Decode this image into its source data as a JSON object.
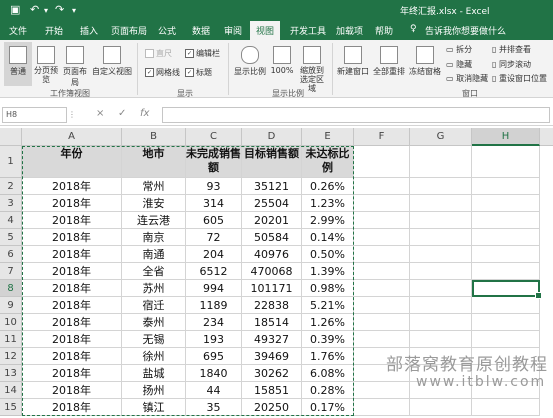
{
  "title_bar": {
    "doc_title": "年终汇报.xlsx  -  Excel"
  },
  "menu_tabs": [
    "文件",
    "开始",
    "插入",
    "页面布局",
    "公式",
    "数据",
    "审阅",
    "视图",
    "开发工具",
    "加载项",
    "帮助"
  ],
  "active_tab": "视图",
  "tell_me": "告诉我你想要做什么",
  "ribbon": {
    "workbook_views": {
      "buttons": [
        "普通",
        "分页预览",
        "页面布局",
        "自定义视图"
      ],
      "group_label": "工作簿视图"
    },
    "show": {
      "checks": [
        {
          "label": "直尺",
          "checked": false,
          "disabled": true
        },
        {
          "label": "编辑栏",
          "checked": true,
          "disabled": false
        },
        {
          "label": "网格线",
          "checked": true,
          "disabled": false
        },
        {
          "label": "标题",
          "checked": true,
          "disabled": false
        }
      ],
      "group_label": "显示"
    },
    "zoom": {
      "buttons": [
        "显示比例",
        "100%",
        "缩放到选定区域"
      ],
      "group_label": "显示比例"
    },
    "window": {
      "buttons": [
        "新建窗口",
        "全部重排",
        "冻结窗格"
      ],
      "small": [
        "拆分",
        "隐藏",
        "取消隐藏"
      ],
      "small2": [
        "并排查看",
        "同步滚动",
        "重设窗口位置"
      ],
      "group_label": "窗口"
    }
  },
  "formula_bar": {
    "name_box": "H8",
    "cancel": "×",
    "enter": "✓",
    "fx": "fx",
    "value": ""
  },
  "columns": [
    "A",
    "B",
    "C",
    "D",
    "E",
    "F",
    "G",
    "H"
  ],
  "selected_column": "H",
  "selected_row": "8",
  "table": {
    "headers": [
      "年份",
      "地市",
      "未完成销售额",
      "目标销售额",
      "未达标比例"
    ],
    "rows": [
      [
        "2018年",
        "常州",
        "93",
        "35121",
        "0.26%"
      ],
      [
        "2018年",
        "淮安",
        "314",
        "25504",
        "1.23%"
      ],
      [
        "2018年",
        "连云港",
        "605",
        "20201",
        "2.99%"
      ],
      [
        "2018年",
        "南京",
        "72",
        "50584",
        "0.14%"
      ],
      [
        "2018年",
        "南通",
        "204",
        "40976",
        "0.50%"
      ],
      [
        "2018年",
        "全省",
        "6512",
        "470068",
        "1.39%"
      ],
      [
        "2018年",
        "苏州",
        "994",
        "101171",
        "0.98%"
      ],
      [
        "2018年",
        "宿迁",
        "1189",
        "22838",
        "5.21%"
      ],
      [
        "2018年",
        "泰州",
        "234",
        "18514",
        "1.26%"
      ],
      [
        "2018年",
        "无锡",
        "193",
        "49327",
        "0.39%"
      ],
      [
        "2018年",
        "徐州",
        "695",
        "39469",
        "1.76%"
      ],
      [
        "2018年",
        "盐城",
        "1840",
        "30262",
        "6.08%"
      ],
      [
        "2018年",
        "扬州",
        "44",
        "15851",
        "0.28%"
      ],
      [
        "2018年",
        "镇江",
        "35",
        "20250",
        "0.17%"
      ]
    ]
  },
  "watermark": {
    "line1": "部落窝教育原创教程",
    "line2": "www.itblw.com"
  }
}
